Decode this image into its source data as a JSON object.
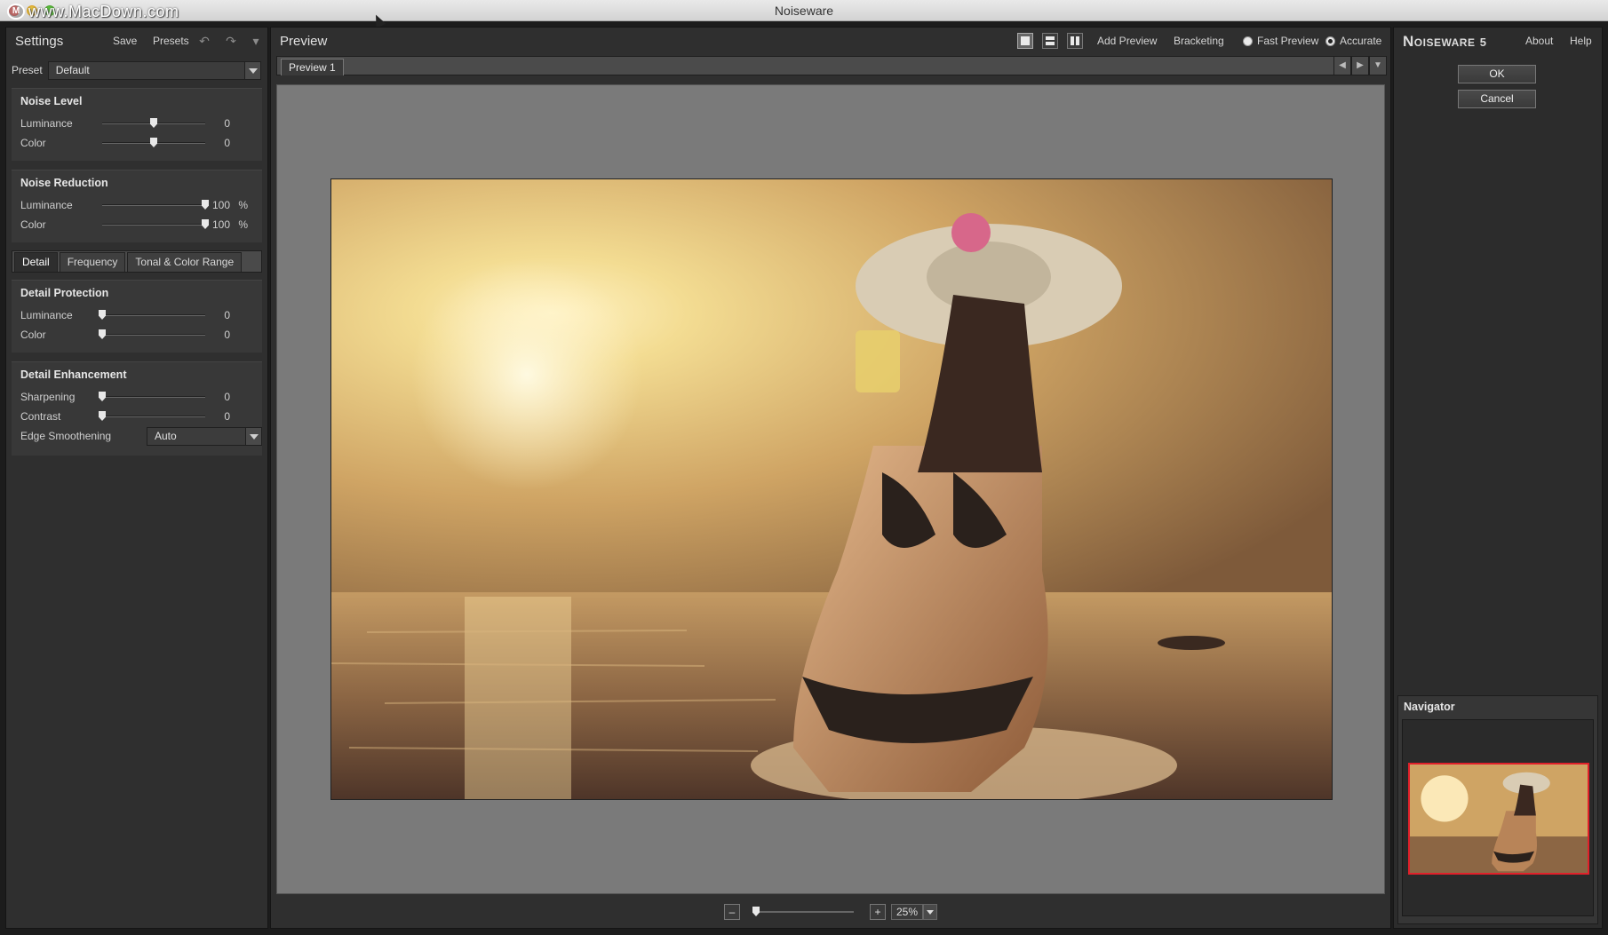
{
  "window": {
    "title": "Noiseware",
    "watermark": "www.MacDown.com",
    "watermark_logo": "M"
  },
  "settings": {
    "title": "Settings",
    "save_label": "Save",
    "presets_label": "Presets",
    "undo_icon": "undo-icon",
    "redo_icon": "redo-icon",
    "preset_label": "Preset",
    "preset_value": "Default",
    "noise_level": {
      "title": "Noise Level",
      "luminance_label": "Luminance",
      "luminance_value": "0",
      "luminance_level": 0.5,
      "color_label": "Color",
      "color_value": "0",
      "color_level": 0.5
    },
    "noise_reduction": {
      "title": "Noise Reduction",
      "luminance_label": "Luminance",
      "luminance_value": "100",
      "luminance_unit": "%",
      "color_label": "Color",
      "color_value": "100",
      "color_unit": "%"
    },
    "tabs": [
      "Detail",
      "Frequency",
      "Tonal & Color Range"
    ],
    "detail_protection": {
      "title": "Detail Protection",
      "luminance_label": "Luminance",
      "luminance_value": "0",
      "color_label": "Color",
      "color_value": "0"
    },
    "detail_enhancement": {
      "title": "Detail Enhancement",
      "sharpening_label": "Sharpening",
      "sharpening_value": "0",
      "contrast_label": "Contrast",
      "contrast_value": "0",
      "edge_label": "Edge Smoothening",
      "edge_value": "Auto"
    }
  },
  "preview": {
    "title": "Preview",
    "add_preview": "Add Preview",
    "bracketing": "Bracketing",
    "fast_preview": "Fast Preview",
    "accurate": "Accurate",
    "selected_mode": "Accurate",
    "tab_label": "Preview 1",
    "zoom_minus": "–",
    "zoom_plus": "+",
    "zoom_value": "25%",
    "zoom_level": 0.0
  },
  "right": {
    "brand": "Noiseware",
    "brand_version": "5",
    "about": "About",
    "help": "Help",
    "ok": "OK",
    "cancel": "Cancel",
    "navigator_title": "Navigator"
  },
  "colors": {
    "accent_red": "#e0202a",
    "panel_bg": "#2f2f2f"
  }
}
